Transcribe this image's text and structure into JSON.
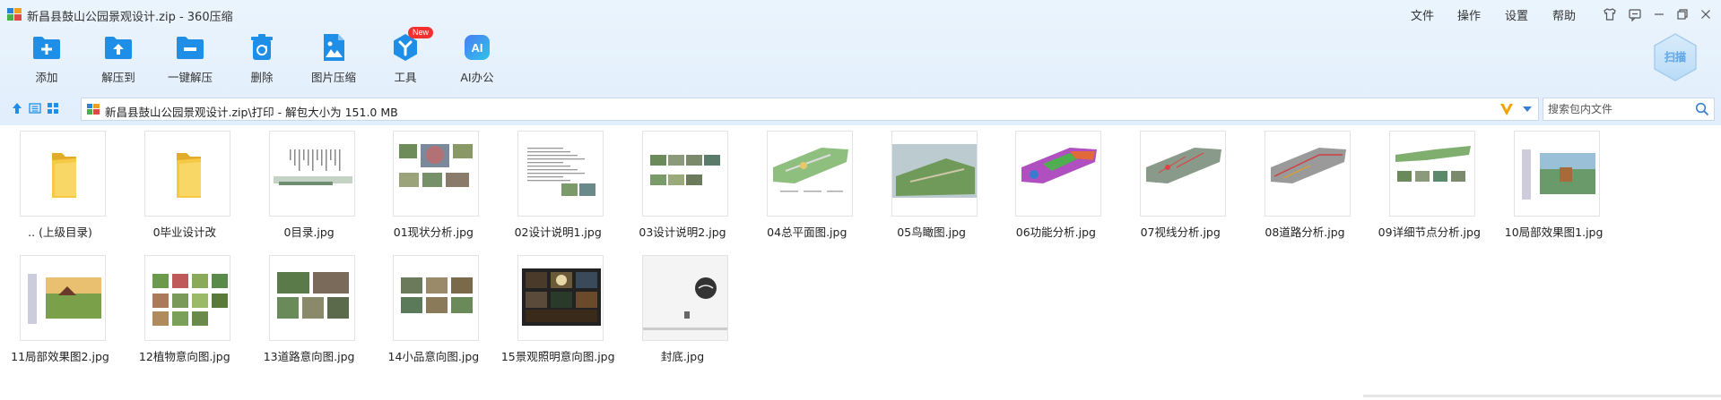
{
  "window": {
    "title": "新昌县鼓山公园景观设计.zip - 360压缩"
  },
  "menu": {
    "items": [
      "文件",
      "操作",
      "设置",
      "帮助"
    ]
  },
  "toolbar": {
    "items": [
      {
        "label": "添加",
        "icon": "add-icon"
      },
      {
        "label": "解压到",
        "icon": "extract-to-icon"
      },
      {
        "label": "一键解压",
        "icon": "quick-extract-icon"
      },
      {
        "label": "删除",
        "icon": "delete-icon"
      },
      {
        "label": "图片压缩",
        "icon": "image-compress-icon"
      },
      {
        "label": "工具",
        "icon": "tools-icon",
        "badge": "New"
      },
      {
        "label": "AI办公",
        "icon": "ai-office-icon",
        "glyph": "AI"
      }
    ]
  },
  "scan": {
    "label": "扫描"
  },
  "address": {
    "path": "新昌县鼓山公园景观设计.zip\\打印 - 解包大小为 151.0 MB",
    "search_placeholder": "搜索包内文件"
  },
  "colors": {
    "accent": "#1e8ee6",
    "toolbar_bg": "#e4f0fb",
    "folder": "#f6c945",
    "badge": "#f23030"
  },
  "files": [
    {
      "name": ".. (上级目录)",
      "kind": "folder"
    },
    {
      "name": "0毕业设计改",
      "kind": "folder"
    },
    {
      "name": "0目录.jpg",
      "kind": "image"
    },
    {
      "name": "01现状分析.jpg",
      "kind": "image"
    },
    {
      "name": "02设计说明1.jpg",
      "kind": "image"
    },
    {
      "name": "03设计说明2.jpg",
      "kind": "image"
    },
    {
      "name": "04总平面图.jpg",
      "kind": "image"
    },
    {
      "name": "05鸟瞰图.jpg",
      "kind": "image"
    },
    {
      "name": "06功能分析.jpg",
      "kind": "image"
    },
    {
      "name": "07视线分析.jpg",
      "kind": "image"
    },
    {
      "name": "08道路分析.jpg",
      "kind": "image"
    },
    {
      "name": "09详细节点分析.jpg",
      "kind": "image"
    },
    {
      "name": "10局部效果图1.jpg",
      "kind": "image"
    },
    {
      "name": "11局部效果图2.jpg",
      "kind": "image"
    },
    {
      "name": "12植物意向图.jpg",
      "kind": "image"
    },
    {
      "name": "13道路意向图.jpg",
      "kind": "image"
    },
    {
      "name": "14小品意向图.jpg",
      "kind": "image"
    },
    {
      "name": "15景观照明意向图.jpg",
      "kind": "image"
    },
    {
      "name": "封底.jpg",
      "kind": "image"
    }
  ]
}
